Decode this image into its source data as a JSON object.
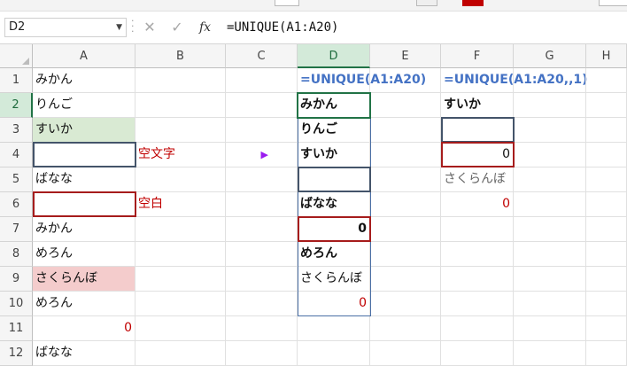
{
  "name_box": {
    "value": "D2"
  },
  "formula_bar": {
    "fx_label": "fx",
    "cancel_glyph": "✕",
    "enter_glyph": "✓",
    "formula": "=UNIQUE(A1:A20)"
  },
  "columns": [
    "A",
    "B",
    "C",
    "D",
    "E",
    "F",
    "G",
    "H"
  ],
  "rows": [
    "1",
    "2",
    "3",
    "4",
    "5",
    "6",
    "7",
    "8",
    "9",
    "10",
    "11",
    "12"
  ],
  "cells": {
    "A1": "みかん",
    "A2": "りんご",
    "A3": "すいか",
    "A4": "",
    "A5": "ばなな",
    "A6": "",
    "A7": "みかん",
    "A8": "めろん",
    "A9": "さくらんぼ",
    "A10": "めろん",
    "A11": "0",
    "A12": "ばなな",
    "B4": "空文字",
    "B6": "空白",
    "C4": "▶",
    "D1": "=UNIQUE(A1:A20)",
    "D2": "みかん",
    "D3": "りんご",
    "D4": "すいか",
    "D5": "",
    "D6": "ばなな",
    "D7": "0",
    "D8": "めろん",
    "D9": "さくらんぼ",
    "D10": "0",
    "F1": "=UNIQUE(A1:A20,,1)",
    "F2": "すいか",
    "F3": "",
    "F4": "0",
    "F5": "さくらんぼ",
    "F6": "0"
  },
  "colors": {
    "selected_header": "#d3ead9",
    "accent_green": "#217346",
    "formula_blue": "#4472c4",
    "note_red": "#c00000",
    "fill_green": "#d9ead3",
    "fill_pink": "#f4cccc",
    "arrow_purple": "#9b1cf0"
  }
}
